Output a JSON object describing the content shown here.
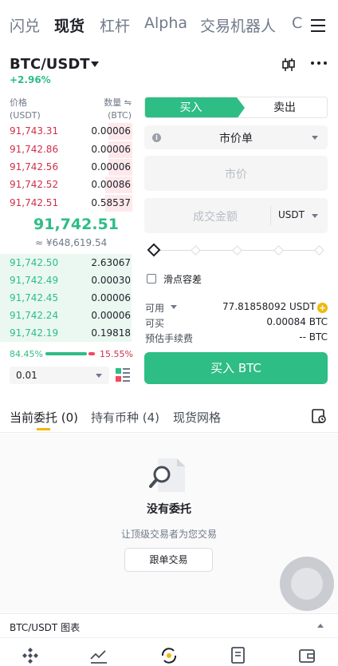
{
  "top_tabs": [
    "闪兑",
    "现货",
    "杠杆",
    "Alpha",
    "交易机器人",
    "C"
  ],
  "active_tab": "现货",
  "header": {
    "pair": "BTC/USDT",
    "change": "+2.96%"
  },
  "orderbook": {
    "price_header": "价格",
    "price_unit": "(USDT)",
    "qty_header": "数量 ⇋",
    "qty_unit": "(BTC)",
    "asks": [
      {
        "price": "91,743.31",
        "qty": "0.00006",
        "depth": 0.18
      },
      {
        "price": "91,742.86",
        "qty": "0.00006",
        "depth": 0.18
      },
      {
        "price": "91,742.56",
        "qty": "0.00006",
        "depth": 0.18
      },
      {
        "price": "91,742.52",
        "qty": "0.00086",
        "depth": 0.2
      },
      {
        "price": "91,742.51",
        "qty": "0.58537",
        "depth": 0.2
      }
    ],
    "last_price": "91,742.51",
    "last_fiat": "≈ ¥648,619.54",
    "bids": [
      {
        "price": "91,742.50",
        "qty": "2.63067"
      },
      {
        "price": "91,742.49",
        "qty": "0.00030"
      },
      {
        "price": "91,742.45",
        "qty": "0.00006"
      },
      {
        "price": "91,742.24",
        "qty": "0.00006"
      },
      {
        "price": "91,742.19",
        "qty": "0.19818"
      }
    ],
    "buy_ratio": "84.45%",
    "sell_ratio": "15.55%",
    "buy_ratio_value": 0.8445,
    "tick_size": "0.01"
  },
  "trade_form": {
    "buy_label": "买入",
    "sell_label": "卖出",
    "order_type": "市价单",
    "price_placeholder": "市价",
    "amount_placeholder": "成交金额",
    "amount_unit": "USDT",
    "slippage_label": "滑点容差",
    "available_label": "可用",
    "available_value": "77.81858092 USDT",
    "can_buy_label": "可买",
    "can_buy_value": "0.00084 BTC",
    "fee_label": "预估手续费",
    "fee_value": "-- BTC",
    "submit_label": "买入 BTC"
  },
  "order_tabs": [
    "当前委托 (0)",
    "持有币种 (4)",
    "现货网格"
  ],
  "empty_state": {
    "title": "没有委托",
    "subtitle": "让顶级交易者为您交易",
    "button": "跟单交易"
  },
  "chart_bar": {
    "label": "BTC/USDT 图表"
  },
  "colors": {
    "buy": "#2ebd85",
    "sell": "#f6465d",
    "accent": "#f0b90b"
  },
  "nav_icons": [
    "home-icon",
    "markets-icon",
    "trade-icon",
    "futures-icon",
    "wallet-icon"
  ]
}
